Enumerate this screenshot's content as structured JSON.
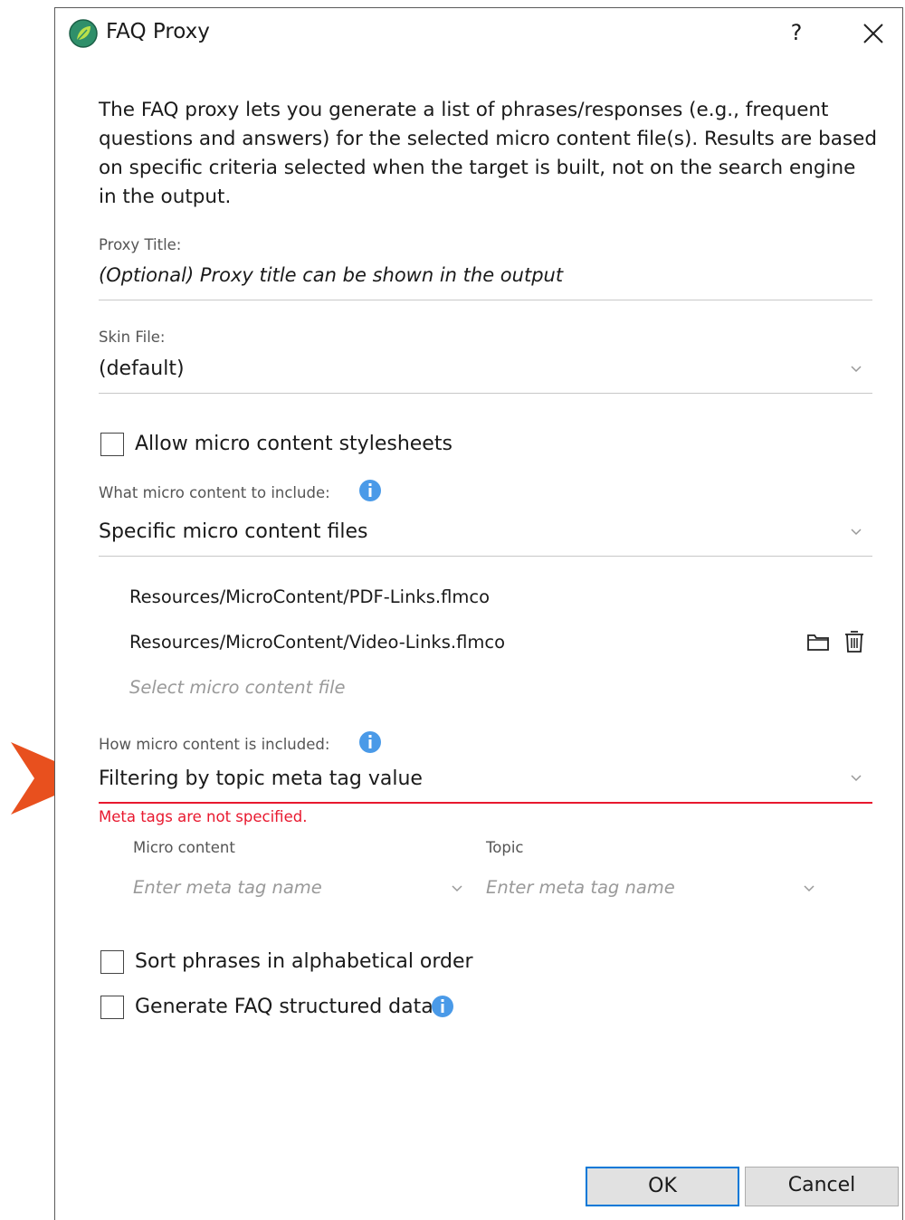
{
  "window": {
    "title": "FAQ Proxy",
    "help_label": "?",
    "close_label": "×"
  },
  "description": "The FAQ proxy lets you generate a list of phrases/responses (e.g., frequent questions and answers) for the selected micro content file(s). Results are based on specific criteria selected when the target is built, not on the search engine in the output.",
  "proxy_title": {
    "label": "Proxy Title:",
    "value": "",
    "placeholder": "(Optional) Proxy title can be shown in the output"
  },
  "skin_file": {
    "label": "Skin File:",
    "selected": "(default)"
  },
  "allow_stylesheets": {
    "label": "Allow micro content stylesheets",
    "checked": false
  },
  "what_include": {
    "label": "What micro content to include:",
    "selected": "Specific micro content files",
    "files": [
      "Resources/MicroContent/PDF-Links.flmco",
      "Resources/MicroContent/Video-Links.flmco"
    ],
    "select_placeholder": "Select micro content file"
  },
  "how_included": {
    "label": "How micro content is included:",
    "selected": "Filtering by topic meta tag value",
    "error": "Meta tags are not specified.",
    "micro_content_header": "Micro content",
    "topic_header": "Topic",
    "micro_content_placeholder": "Enter meta tag name",
    "topic_placeholder": "Enter meta tag name"
  },
  "sort_phrases": {
    "label": "Sort phrases in alphabetical order",
    "checked": false
  },
  "generate_faq": {
    "label": "Generate FAQ structured data",
    "checked": false
  },
  "buttons": {
    "ok": "OK",
    "cancel": "Cancel"
  },
  "colors": {
    "error": "#e8182e",
    "accent": "#0078d7",
    "info": "#4a9ae8",
    "pointer_arrow": "#e8501e"
  }
}
